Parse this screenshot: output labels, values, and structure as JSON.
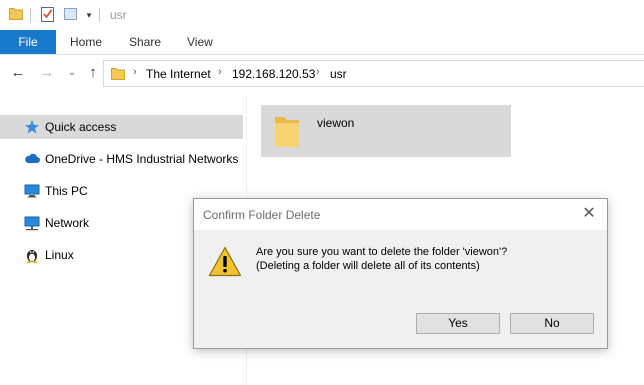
{
  "window": {
    "title": "usr"
  },
  "quick_access_toolbar": {
    "icons": [
      "folder-icon",
      "properties-icon",
      "new-folder-icon",
      "customize-dropdown-icon"
    ],
    "customize_glyph": "▾"
  },
  "ribbon": {
    "tabs": [
      {
        "label": "File",
        "active": true
      },
      {
        "label": "Home"
      },
      {
        "label": "Share"
      },
      {
        "label": "View"
      }
    ]
  },
  "navigation": {
    "back_glyph": "←",
    "forward_glyph": "→",
    "recent_glyph": "⌄",
    "up_glyph": "↑",
    "breadcrumb": [
      "The Internet",
      "192.168.120.53",
      "usr"
    ],
    "separator": "›"
  },
  "sidebar": {
    "items": [
      {
        "label": "Quick access",
        "icon": "star-icon",
        "selected": true
      },
      {
        "label": "OneDrive - HMS Industrial Networks",
        "icon": "cloud-icon"
      },
      {
        "label": "This PC",
        "icon": "computer-icon"
      },
      {
        "label": "Network",
        "icon": "network-icon"
      },
      {
        "label": "Linux",
        "icon": "linux-penguin-icon"
      }
    ]
  },
  "content": {
    "items": [
      {
        "name": "viewon",
        "icon": "folder-icon",
        "selected": true
      }
    ]
  },
  "dialog": {
    "title": "Confirm Folder Delete",
    "close_glyph": "✕",
    "message_line1": "Are you sure you want to delete the folder 'viewon'?",
    "message_line2": "(Deleting a folder will delete all of its contents)",
    "yes_label": "Yes",
    "no_label": "No"
  },
  "colors": {
    "file_tab": "#1979ca",
    "selection": "#d9d9d9",
    "folder": "#f3c858",
    "warning": "#f2c230"
  }
}
